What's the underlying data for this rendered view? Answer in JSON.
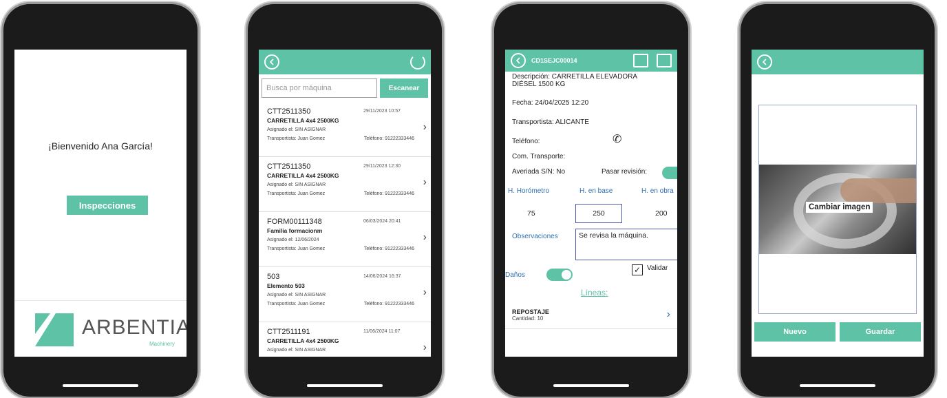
{
  "colors": {
    "accent": "#5dc2a6",
    "link": "#2e6fb0"
  },
  "screen1": {
    "welcome": "¡Bienvenido Ana García!",
    "button": "Inspecciones",
    "logo_text": "ARBENTIA",
    "logo_sub": "Machinery"
  },
  "screen2": {
    "search_placeholder": "Busca por máquina",
    "scan_label": "Escanear",
    "items": [
      {
        "code": "CTT2511350",
        "date": "29/11/2023 10:57",
        "name": "CARRETILLA 4x4 2500KG",
        "assigned": "Asignado el: SIN ASIGNAR",
        "transport": "Transportista: Juan Gomez",
        "phone": "Teléfono: 91222333446"
      },
      {
        "code": "CTT2511350",
        "date": "29/11/2023 12:30",
        "name": "CARRETILLA 4x4 2500KG",
        "assigned": "Asignado el: SIN ASIGNAR",
        "transport": "Transportista: Juan Gomez",
        "phone": "Teléfono: 91222333446"
      },
      {
        "code": "FORM00111348",
        "date": "06/03/2024 20:41",
        "name": "Familia formacionm",
        "assigned": "Asignado el: 12/06/2024",
        "transport": "Transportista: Juan Gomez",
        "phone": "Teléfono: 91222333446"
      },
      {
        "code": "503",
        "date": "14/06/2024 16:37",
        "name": "Elemento 503",
        "assigned": "Asignado el: SIN ASIGNAR",
        "transport": "Transportista: Juan Gomez",
        "phone": "Teléfono: 91222333446"
      },
      {
        "code": "CTT2511191",
        "date": "11/06/2024 11:07",
        "name": "CARRETILLA 4x4 2500KG",
        "assigned": "Asignado el: SIN ASIGNAR",
        "transport": "",
        "phone": ""
      }
    ]
  },
  "screen3": {
    "title": "CD1SEJC00014",
    "description": "Descripción: CARRETILLA ELEVADORA",
    "description2": "DIÉSEL 1500 KG",
    "fecha": "Fecha: 24/04/2025 12:20",
    "transportista": "Transportista: ALICANTE",
    "telefono": "Teléfono:",
    "com_transporte": "Com. Transporte:",
    "averiada": "Averiada S/N: No",
    "pasar_revision": "Pasar revisión:",
    "h_horometro_lbl": "H. Horómetro",
    "h_base_lbl": "H. en base",
    "h_obra_lbl": "H. en obra",
    "h_horometro": "75",
    "h_base": "250",
    "h_obra": "200",
    "observaciones_lbl": "Observaciones",
    "observaciones": "Se revisa la máquina.",
    "validar": "Validar",
    "danos": "Daños",
    "lineas": "Líneas:",
    "line_title": "REPOSTAJE",
    "line_sub": "Cantidad: 10",
    "pasar_revision_on": true,
    "danos_on": true,
    "validar_checked": true
  },
  "screen4": {
    "change_image": "Cambiar imagen",
    "new_label": "Nuevo",
    "save_label": "Guardar"
  }
}
